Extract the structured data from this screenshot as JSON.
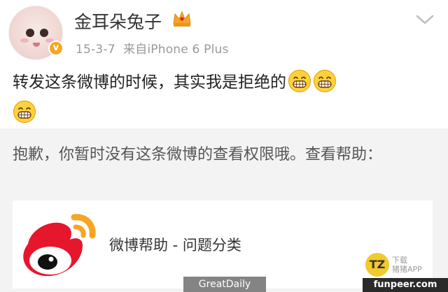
{
  "post": {
    "username": "金耳朵兔子",
    "verified_badge": "v",
    "date": "15-3-7",
    "source": "来自iPhone 6 Plus",
    "content": "转发这条微博的时候，其实我是拒绝的",
    "emojis": [
      "grin-emoji",
      "grin-emoji",
      "grin-emoji"
    ],
    "menu_icon": "chevron-down-icon",
    "crown_icon": "crown-icon"
  },
  "repost": {
    "notice": "抱歉，你暂时没有这条微博的查看权限哦。查看帮助：",
    "card": {
      "logo_icon": "weibo-logo-icon",
      "title": "微博帮助 - 问题分类"
    }
  },
  "watermarks": {
    "greatdaily": "GreatDaily",
    "tz_logo": "TZ",
    "tz_line1": "下载",
    "tz_line2": "猪猪APP",
    "funpeer": "funpeer.com"
  },
  "colors": {
    "meta_gray": "#999999",
    "repost_bg": "#f3f3f3",
    "weibo_red": "#e6162d",
    "weibo_orange": "#f5a623"
  }
}
